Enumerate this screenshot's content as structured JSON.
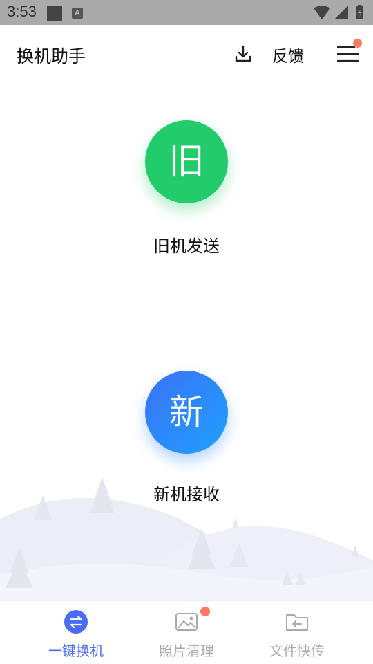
{
  "status_bar": {
    "time": "3:53",
    "notification_letter": "A"
  },
  "header": {
    "title": "换机助手",
    "download_icon": "download-icon",
    "feedback_label": "反馈",
    "menu_icon": "menu-icon",
    "menu_badge_color": "#ff7a65"
  },
  "main": {
    "old_device": {
      "icon_text": "旧",
      "label": "旧机发送",
      "color": "#22cc6a"
    },
    "new_device": {
      "icon_text": "新",
      "label": "新机接收",
      "color": "#2a8cff"
    }
  },
  "bottom_nav": {
    "items": [
      {
        "label": "一键换机",
        "icon": "swap-icon",
        "active": true,
        "color": "#4a6cf7"
      },
      {
        "label": "照片清理",
        "icon": "image-icon",
        "active": false,
        "badge": true,
        "color": "#aaaaaa"
      },
      {
        "label": "文件快传",
        "icon": "folder-transfer-icon",
        "active": false,
        "color": "#aaaaaa"
      }
    ]
  }
}
